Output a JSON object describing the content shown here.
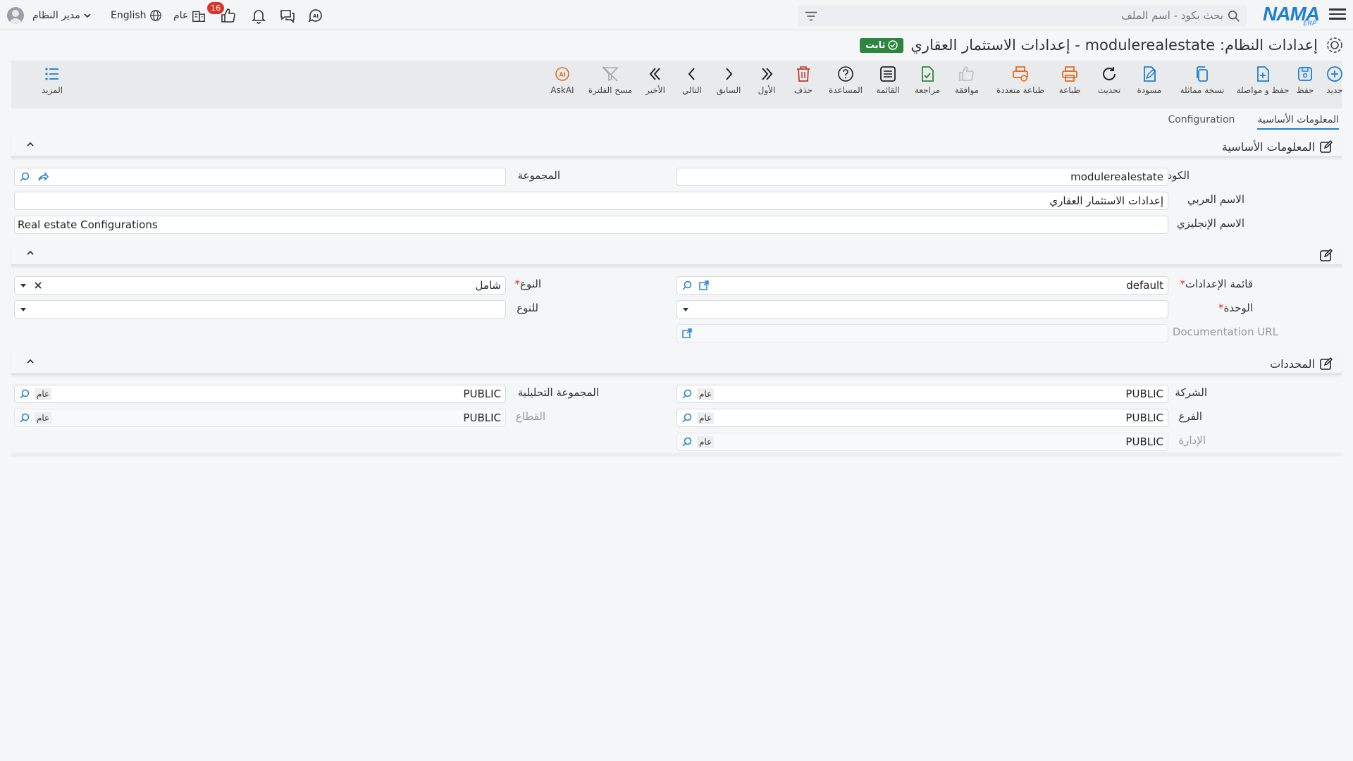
{
  "topbar": {
    "logo": "NAMA",
    "logo_sub": "ERP",
    "search_placeholder": "بحث بكود - اسم الملف",
    "notifications_count": "16",
    "public_label": "عام",
    "language": "English",
    "user_name": "مدير النظام"
  },
  "title": {
    "text": "إعدادات النظام: modulerealestate - إعدادات الاستثمار العقاري",
    "status": "ثابت"
  },
  "toolbar": {
    "new": "جديد",
    "save": "حفظ",
    "save_continue": "حفظ و مواصلة",
    "duplicate": "نسخة مماثلة",
    "draft": "مسودة",
    "refresh": "تحديث",
    "print": "طباعة",
    "multi_print": "طباعة متعددة",
    "approve": "موافقة",
    "review": "مراجعة",
    "list": "القائمة",
    "help": "المساعدة",
    "delete": "حذف",
    "first": "الأول",
    "previous": "السابق",
    "next": "التالي",
    "last": "الأخير",
    "clear_filter": "مسح الفلترة",
    "ask_ai": "AskAI",
    "more": "المزيد"
  },
  "tabs": {
    "basic_info": "المعلومات الأساسية",
    "configuration": "Configuration"
  },
  "section_basic": {
    "title": "المعلومات الأساسية",
    "code_label": "الكود",
    "code_value": "modulerealestate",
    "group_label": "المجموعة",
    "arabic_name_label": "الاسم العربي",
    "arabic_name_value": "إعدادات الاستثمار العقاري",
    "english_name_label": "الاسم الإنجليزي",
    "english_name_value": "Real estate Configurations"
  },
  "section_config": {
    "settings_list_label": "قائمة الإعدادات",
    "settings_list_value": "default",
    "type_label": "النوع",
    "type_value": "شامل",
    "unit_label": "الوحدة",
    "for_type_label": "للنوع",
    "doc_url_label": "Documentation URL"
  },
  "section_dims": {
    "title": "المحددات",
    "company_label": "الشركة",
    "company_value": "PUBLIC",
    "company_tag": "عام",
    "analytic_group_label": "المجموعة التحليلية",
    "analytic_group_value": "PUBLIC",
    "analytic_group_tag": "عام",
    "branch_label": "الفرع",
    "branch_value": "PUBLIC",
    "branch_tag": "عام",
    "sector_label": "القطاع",
    "sector_value": "PUBLIC",
    "sector_tag": "عام",
    "department_label": "الإدارة",
    "department_value": "PUBLIC",
    "department_tag": "عام"
  }
}
